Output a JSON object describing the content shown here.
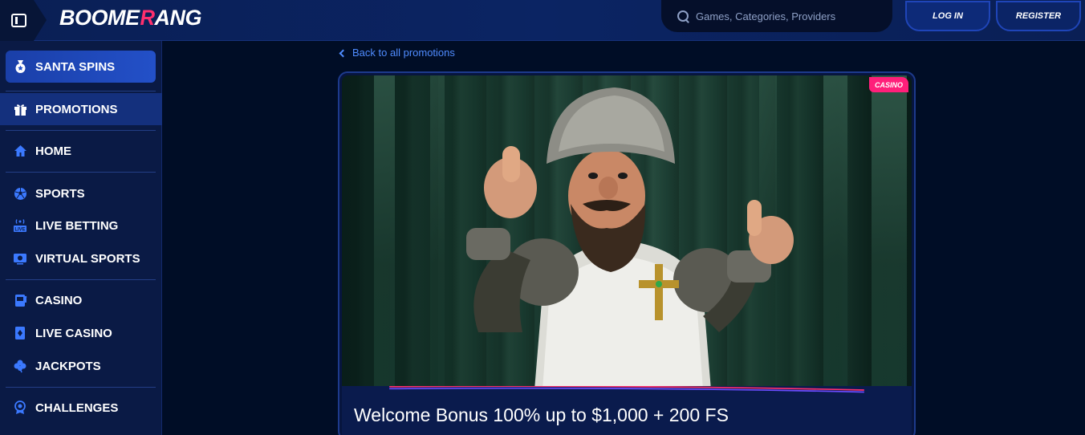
{
  "header": {
    "logo_pre": "BOOME",
    "logo_r": "R",
    "logo_post": "ANG",
    "search_placeholder": "Games, Categories, Providers",
    "login_label": "LOG IN",
    "register_label": "REGISTER"
  },
  "sidebar": {
    "items": [
      {
        "label": "SANTA SPINS",
        "icon": "medal-star-icon"
      },
      {
        "label": "PROMOTIONS",
        "icon": "gift-icon"
      },
      {
        "label": "HOME",
        "icon": "home-icon"
      },
      {
        "label": "SPORTS",
        "icon": "soccer-ball-icon"
      },
      {
        "label": "LIVE BETTING",
        "icon": "live-broadcast-icon"
      },
      {
        "label": "VIRTUAL SPORTS",
        "icon": "virtual-screen-icon"
      },
      {
        "label": "CASINO",
        "icon": "slot-machine-icon"
      },
      {
        "label": "LIVE CASINO",
        "icon": "playing-card-icon"
      },
      {
        "label": "JACKPOTS",
        "icon": "clover-icon"
      },
      {
        "label": "CHALLENGES",
        "icon": "rosette-icon"
      }
    ]
  },
  "main": {
    "back_label": "Back to all promotions",
    "promo": {
      "badge": "CASINO",
      "title": "Welcome Bonus 100% up to $1,000 + 200 FS"
    }
  },
  "colors": {
    "background": "#000d26",
    "header": "#0b2463",
    "sidebar": "#0a1a45",
    "accent_blue": "#3b79ff",
    "link_blue": "#4f8cff",
    "badge_pink": "#ff1f7a",
    "logo_accent": "#ff2f6d"
  }
}
